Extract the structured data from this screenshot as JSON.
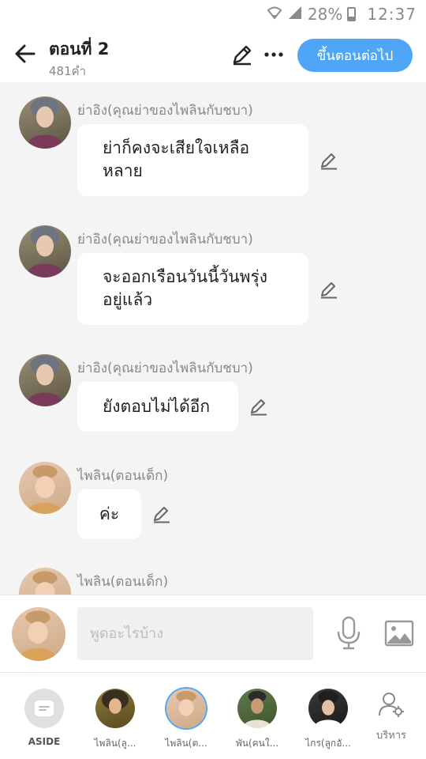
{
  "status": {
    "battery": "28%",
    "time": "12:37"
  },
  "header": {
    "title": "ตอนที่ 2",
    "word_count": "481คำ",
    "next_label": "ขึ้นตอนต่อไป"
  },
  "messages": [
    {
      "sender": "ย่าอิง(คุณย่าของไพลินกับชบา)",
      "text": "ย่าก็คงจะเสียใจเหลือ\nหลาย"
    },
    {
      "sender": "ย่าอิง(คุณย่าของไพลินกับชบา)",
      "text": "จะออกเรือนวันนี้วันพรุ่ง\nอยู่แล้ว"
    },
    {
      "sender": "ย่าอิง(คุณย่าของไพลินกับชบา)",
      "text": "ยังตอบไม่ได้อีก"
    },
    {
      "sender": "ไพลิน(ตอนเด็ก)",
      "text": "ค่ะ"
    },
    {
      "sender": "ไพลิน(ตอนเด็ก)",
      "text": ""
    }
  ],
  "input": {
    "placeholder": "พูดอะไรบ้าง"
  },
  "characters": [
    {
      "label": "ASIDE",
      "icon": "aside-icon"
    },
    {
      "label": "ไพลิน(ลู..."
    },
    {
      "label": "ไพลิน(ต...",
      "selected": true
    },
    {
      "label": "พัน(คนใ..."
    },
    {
      "label": "ไกร(ลูกอั..."
    }
  ],
  "manage_label": "บริหาร",
  "colors": {
    "accent": "#4fa6f6",
    "bubble": "#ffffff",
    "background": "#f4f4f4"
  }
}
